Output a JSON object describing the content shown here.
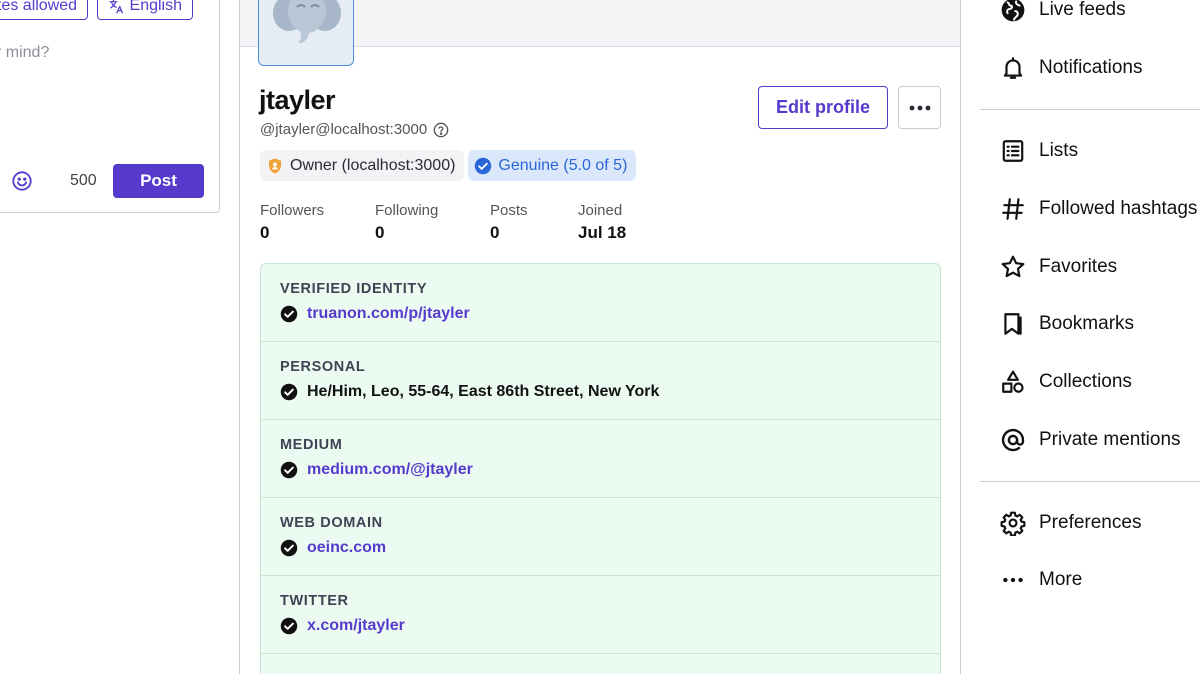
{
  "compose": {
    "quote_chip": "tes allowed",
    "language_chip": "English",
    "placeholder": "r mind?",
    "char_count": "500",
    "post_label": "Post"
  },
  "profile": {
    "display_name": "jtayler",
    "handle": "@jtayler@localhost:3000",
    "owner_badge": "Owner (localhost:3000)",
    "genuine_badge": "Genuine (5.0 of 5)",
    "edit_label": "Edit profile",
    "stats": [
      {
        "label": "Followers",
        "value": "0"
      },
      {
        "label": "Following",
        "value": "0"
      },
      {
        "label": "Posts",
        "value": "0"
      },
      {
        "label": "Joined",
        "value": "Jul 18"
      }
    ],
    "fields": [
      {
        "label": "VERIFIED IDENTITY",
        "value": "truanon.com/p/jtayler"
      },
      {
        "label": "PERSONAL",
        "value": "He/Him, Leo, 55-64, East 86th Street, New York"
      },
      {
        "label": "MEDIUM",
        "value": "medium.com/@jtayler"
      },
      {
        "label": "WEB DOMAIN",
        "value": "oeinc.com"
      },
      {
        "label": "TWITTER",
        "value": "x.com/jtayler"
      }
    ]
  },
  "nav": {
    "items": [
      {
        "label": "Live feeds",
        "icon": "globe-icon"
      },
      {
        "label": "Notifications",
        "icon": "bell-icon"
      },
      {
        "label": "Lists",
        "icon": "list-icon"
      },
      {
        "label": "Followed hashtags",
        "icon": "hashtag-icon"
      },
      {
        "label": "Favorites",
        "icon": "star-icon"
      },
      {
        "label": "Bookmarks",
        "icon": "bookmark-icon"
      },
      {
        "label": "Collections",
        "icon": "shapes-icon"
      },
      {
        "label": "Private mentions",
        "icon": "at-icon"
      },
      {
        "label": "Preferences",
        "icon": "gear-icon"
      },
      {
        "label": "More",
        "icon": "ellipsis-icon"
      }
    ]
  },
  "colors": {
    "accent": "#563acc",
    "verified_bg": "#ecfbf2",
    "genuine_bg": "#dbe8fb",
    "genuine_text": "#2b66d9",
    "owner_icon": "#f0a23a"
  }
}
